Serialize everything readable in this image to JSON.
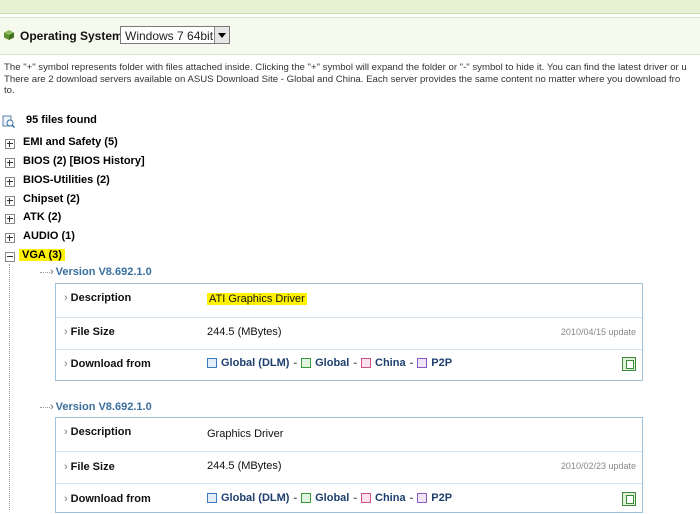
{
  "os": {
    "label": "Operating System:",
    "selected": "Windows 7 64bit"
  },
  "info": {
    "line1": "The \"+\" symbol represents folder with files attached inside. Clicking the \"+\" symbol will expand the folder or \"-\" symbol to hide it. You can find the latest driver or u",
    "line2": "There are 2 download servers available on ASUS Download Site - Global and China. Each server provides the same content no matter where you download fro",
    "line3": "to."
  },
  "files_found": "95 files found",
  "categories": [
    {
      "label": "EMI and Safety  (5)"
    },
    {
      "label": "BIOS  (2)  [BIOS History]"
    },
    {
      "label": "BIOS-Utilities  (2)"
    },
    {
      "label": "Chipset  (2)"
    },
    {
      "label": "ATK  (2)"
    },
    {
      "label": "AUDIO  (1)"
    },
    {
      "label": "VGA  (3)"
    }
  ],
  "labels": {
    "description": "Description",
    "file_size": "File Size",
    "download_from": "Download from"
  },
  "download_links": {
    "global_dlm": "Global (DLM)",
    "global": "Global",
    "china": "China",
    "p2p": "P2P",
    "sep": "-"
  },
  "colors": {
    "highlight": "#fff200",
    "version_text": "#3a6e9e",
    "panel_border": "#9fc2dc"
  },
  "drivers": [
    {
      "version": "Version V8.692.1.0",
      "description": "ATI Graphics Driver",
      "file_size": "244.5 (MBytes)",
      "date": "2010/04/15 update"
    },
    {
      "version": "Version V8.692.1.0",
      "description": "Graphics Driver",
      "file_size": "244.5 (MBytes)",
      "date": "2010/02/23 update"
    }
  ]
}
